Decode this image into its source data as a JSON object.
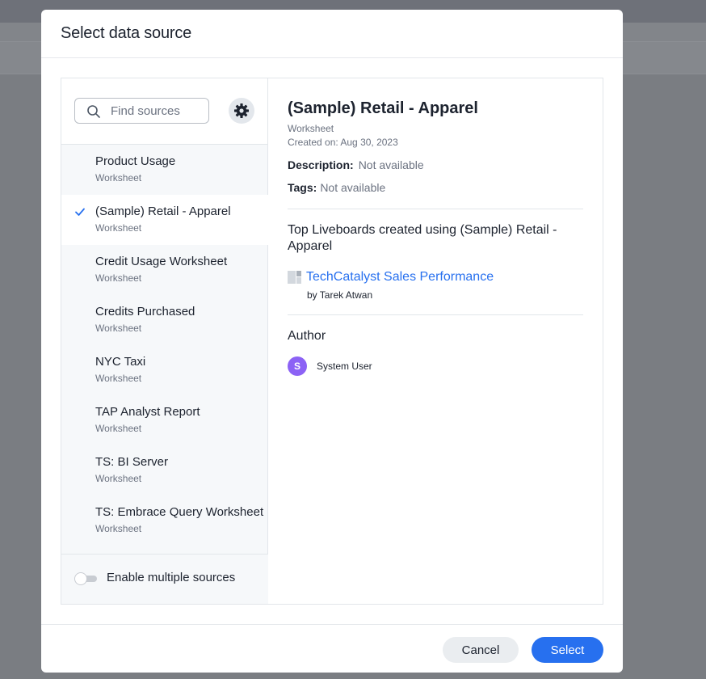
{
  "modal": {
    "title": "Select data source"
  },
  "search": {
    "placeholder": "Find sources",
    "value": ""
  },
  "sources": [
    {
      "name": "Product Usage",
      "type": "Worksheet",
      "selected": false
    },
    {
      "name": "(Sample) Retail - Apparel",
      "type": "Worksheet",
      "selected": true
    },
    {
      "name": "Credit Usage Worksheet",
      "type": "Worksheet",
      "selected": false
    },
    {
      "name": "Credits Purchased",
      "type": "Worksheet",
      "selected": false
    },
    {
      "name": "NYC Taxi",
      "type": "Worksheet",
      "selected": false
    },
    {
      "name": "TAP Analyst Report",
      "type": "Worksheet",
      "selected": false
    },
    {
      "name": "TS: BI Server",
      "type": "Worksheet",
      "selected": false
    },
    {
      "name": "TS: Embrace Query Worksheet",
      "type": "Worksheet",
      "selected": false
    }
  ],
  "multi": {
    "label": "Enable multiple sources",
    "enabled": false
  },
  "details": {
    "title": "(Sample) Retail - Apparel",
    "type": "Worksheet",
    "created": "Created on: Aug 30, 2023",
    "description_label": "Description:",
    "description_value": "Not available",
    "tags_label": "Tags:",
    "tags_value": "Not available",
    "liveboards_heading": "Top Liveboards created using (Sample) Retail - Apparel",
    "liveboard_name": "TechCatalyst Sales Performance",
    "liveboard_by": "by Tarek Atwan",
    "author_heading": "Author",
    "author_initial": "S",
    "author_name": "System User"
  },
  "footer": {
    "cancel_label": "Cancel",
    "select_label": "Select"
  },
  "colors": {
    "accent": "#2770ef",
    "avatar": "#8c62f5"
  },
  "icons": {
    "search": "search-icon",
    "settings": "gear-icon",
    "selected": "check-icon",
    "liveboard": "liveboard-icon"
  }
}
